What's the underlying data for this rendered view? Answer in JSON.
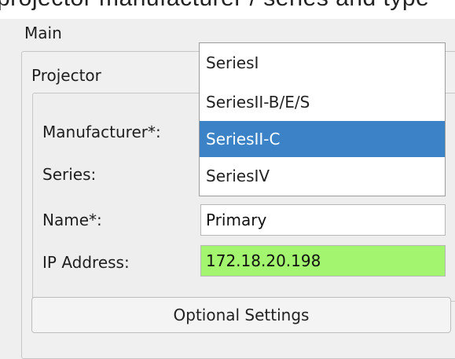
{
  "header": {
    "text": "projector manufacturer / series and type"
  },
  "main": {
    "label": "Main"
  },
  "projector": {
    "label": "Projector",
    "fields": {
      "manufacturer_label": "Manufacturer*:",
      "series_label": "Series:",
      "name_label": "Name*:",
      "name_value": "Primary",
      "ip_label": "IP Address:",
      "ip_value": "172.18.20.198"
    },
    "optional_settings_label": "Optional Settings"
  },
  "series_dropdown": {
    "options": [
      "SeriesI",
      "SeriesII-B/E/S",
      "SeriesII-C",
      "SeriesIV"
    ],
    "selected": "SeriesII-C"
  },
  "colors": {
    "selection": "#3b83c6",
    "valid_input": "#a3f46e"
  }
}
